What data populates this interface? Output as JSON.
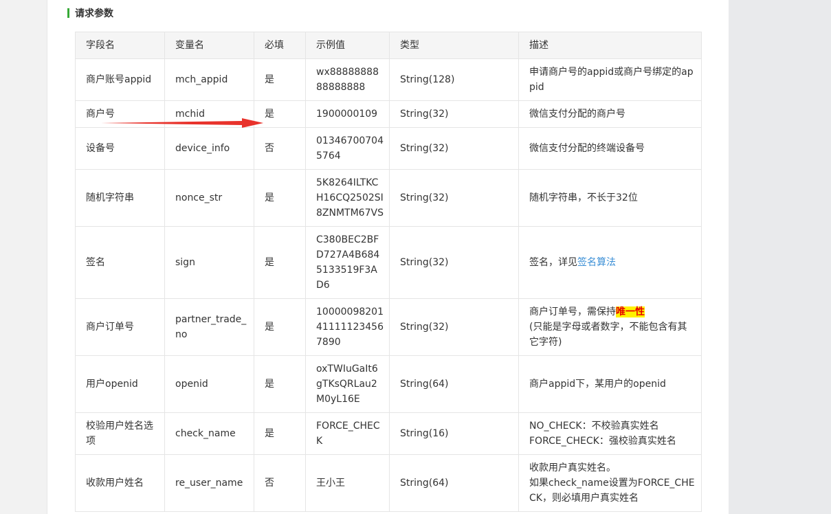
{
  "section": {
    "title": "请求参数"
  },
  "table": {
    "headers": [
      "字段名",
      "变量名",
      "必填",
      "示例值",
      "类型",
      "描述"
    ],
    "rows": [
      {
        "field": "商户账号appid",
        "var": "mch_appid",
        "required": "是",
        "example": "wx8888888888888888",
        "type": "String(128)",
        "desc": "申请商户号的appid或商户号绑定的appid"
      },
      {
        "field": "商户号",
        "var": "mchid",
        "required": "是",
        "example": "1900000109",
        "type": "String(32)",
        "desc": "微信支付分配的商户号"
      },
      {
        "field": "设备号",
        "var": "device_info",
        "required": "否",
        "example": "013467007045764",
        "type": "String(32)",
        "desc": "微信支付分配的终端设备号"
      },
      {
        "field": "随机字符串",
        "var": "nonce_str",
        "required": "是",
        "example": "5K8264ILTKCH16CQ2502SI8ZNMTM67VS",
        "type": "String(32)",
        "desc": "随机字符串，不长于32位"
      },
      {
        "field": "签名",
        "var": "sign",
        "required": "是",
        "example": "C380BEC2BFD727A4B6845133519F3AD6",
        "type": "String(32)",
        "desc_prefix": "签名，详见",
        "desc_link": "签名算法"
      },
      {
        "field": "商户订单号",
        "var": "partner_trade_no",
        "required": "是",
        "example": "10000098201411111234567890",
        "type": "String(32)",
        "desc_prefix": "商户订单号，需保持",
        "desc_highlight": "唯一性",
        "desc_rest": "(只能是字母或者数字，不能包含有其它字符)"
      },
      {
        "field": "用户openid",
        "var": "openid",
        "required": "是",
        "example": "oxTWIuGaIt6gTKsQRLau2M0yL16E",
        "type": "String(64)",
        "desc": "商户appid下，某用户的openid"
      },
      {
        "field": "校验用户姓名选项",
        "var": "check_name",
        "required": "是",
        "example": "FORCE_CHECK",
        "type": "String(16)",
        "desc_line1": "NO_CHECK：不校验真实姓名",
        "desc_line2": "FORCE_CHECK：强校验真实姓名"
      },
      {
        "field": "收款用户姓名",
        "var": "re_user_name",
        "required": "否",
        "example": "王小王",
        "type": "String(64)",
        "desc_line1": "收款用户真实姓名。",
        "desc_line2": "如果check_name设置为FORCE_CHECK，则必填用户真实姓名"
      }
    ]
  },
  "colors": {
    "accent_green": "#36a936",
    "link_blue": "#3b8fd6",
    "arrow_red": "#e8322b",
    "highlight_bg": "#fff200"
  }
}
